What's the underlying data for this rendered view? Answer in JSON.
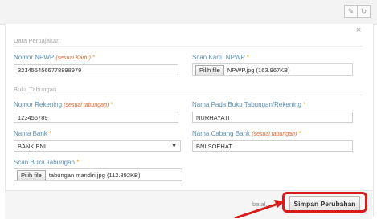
{
  "toolbar": {
    "edit_icon": "pencil-icon",
    "refresh_icon": "refresh-icon"
  },
  "close_symbol": "×",
  "sections": {
    "tax": "Data Perpajakan",
    "bank": "Buku Tabungan"
  },
  "tax": {
    "npwp_label": "Nomor NPWP",
    "npwp_hint": "(sesuai Kartu)",
    "npwp_value": "3214554566778898979",
    "scan_npwp_label": "Scan Kartu NPWP",
    "scan_npwp_button": "Pilih file",
    "scan_npwp_file": "NPWP.jpg (163.967KB)"
  },
  "bank": {
    "account_label": "Nomor Rekening",
    "account_hint": "(sesuai tabungan)",
    "account_value": "123456789",
    "holder_label": "Nama Pada Buku Tabungan/Rekening",
    "holder_value": "NURHAYATI",
    "bank_label": "Nama Bank",
    "bank_value": "BANK BNI",
    "branch_label": "Nama Cabang Bank",
    "branch_hint": "(sesuai tabungan)",
    "branch_value": "BNI SOEHAT",
    "scan_book_label": "Scan Buku Tabungan",
    "scan_book_button": "Pilih file",
    "scan_book_file": "tabungan mandiri.jpg (112.392KB)"
  },
  "required_mark": "*",
  "footer": {
    "cancel_label": "batal.",
    "save_label": "Simpan Perubahan"
  },
  "colors": {
    "highlight": "#d91b1b",
    "label": "#5a8fb0",
    "required": "#f3a01c"
  }
}
